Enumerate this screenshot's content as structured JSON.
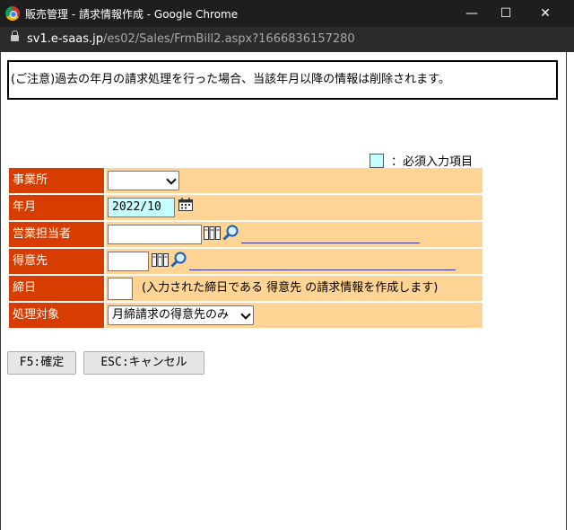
{
  "window": {
    "title": "販売管理 - 請求情報作成 - Google Chrome",
    "url_domain": "sv1.e-saas.jp",
    "url_path": "/es02/Sales/FrmBill2.aspx?1666836157280",
    "minimize_glyph": "—",
    "maximize_glyph": "☐",
    "close_glyph": "✕"
  },
  "notice": "(ご注意)過去の年月の請求処理を行った場合、当該年月以降の情報は削除されます。",
  "legend": {
    "text": "：必須入力項目",
    "color": "#c6ffff"
  },
  "form": {
    "office": {
      "label": "事業所",
      "value": ""
    },
    "year_month": {
      "label": "年月",
      "value": "2022/10"
    },
    "sales_rep": {
      "label": "営業担当者",
      "value": "",
      "name": ""
    },
    "customer": {
      "label": "得意先",
      "value": "",
      "name": ""
    },
    "closing_day": {
      "label": "締日",
      "value": "",
      "hint": "(入力された締日である 得意先 の請求情報を作成します)"
    },
    "process_target": {
      "label": "処理対象",
      "value": "月締請求の得意先のみ"
    }
  },
  "buttons": {
    "confirm": "F5:確定",
    "cancel": "ESC:キャンセル"
  },
  "colors": {
    "label_bg": "#d73c00",
    "value_bg": "#ffd494",
    "required_bg": "#c6ffff",
    "titlebar": "#1e1e1e"
  }
}
